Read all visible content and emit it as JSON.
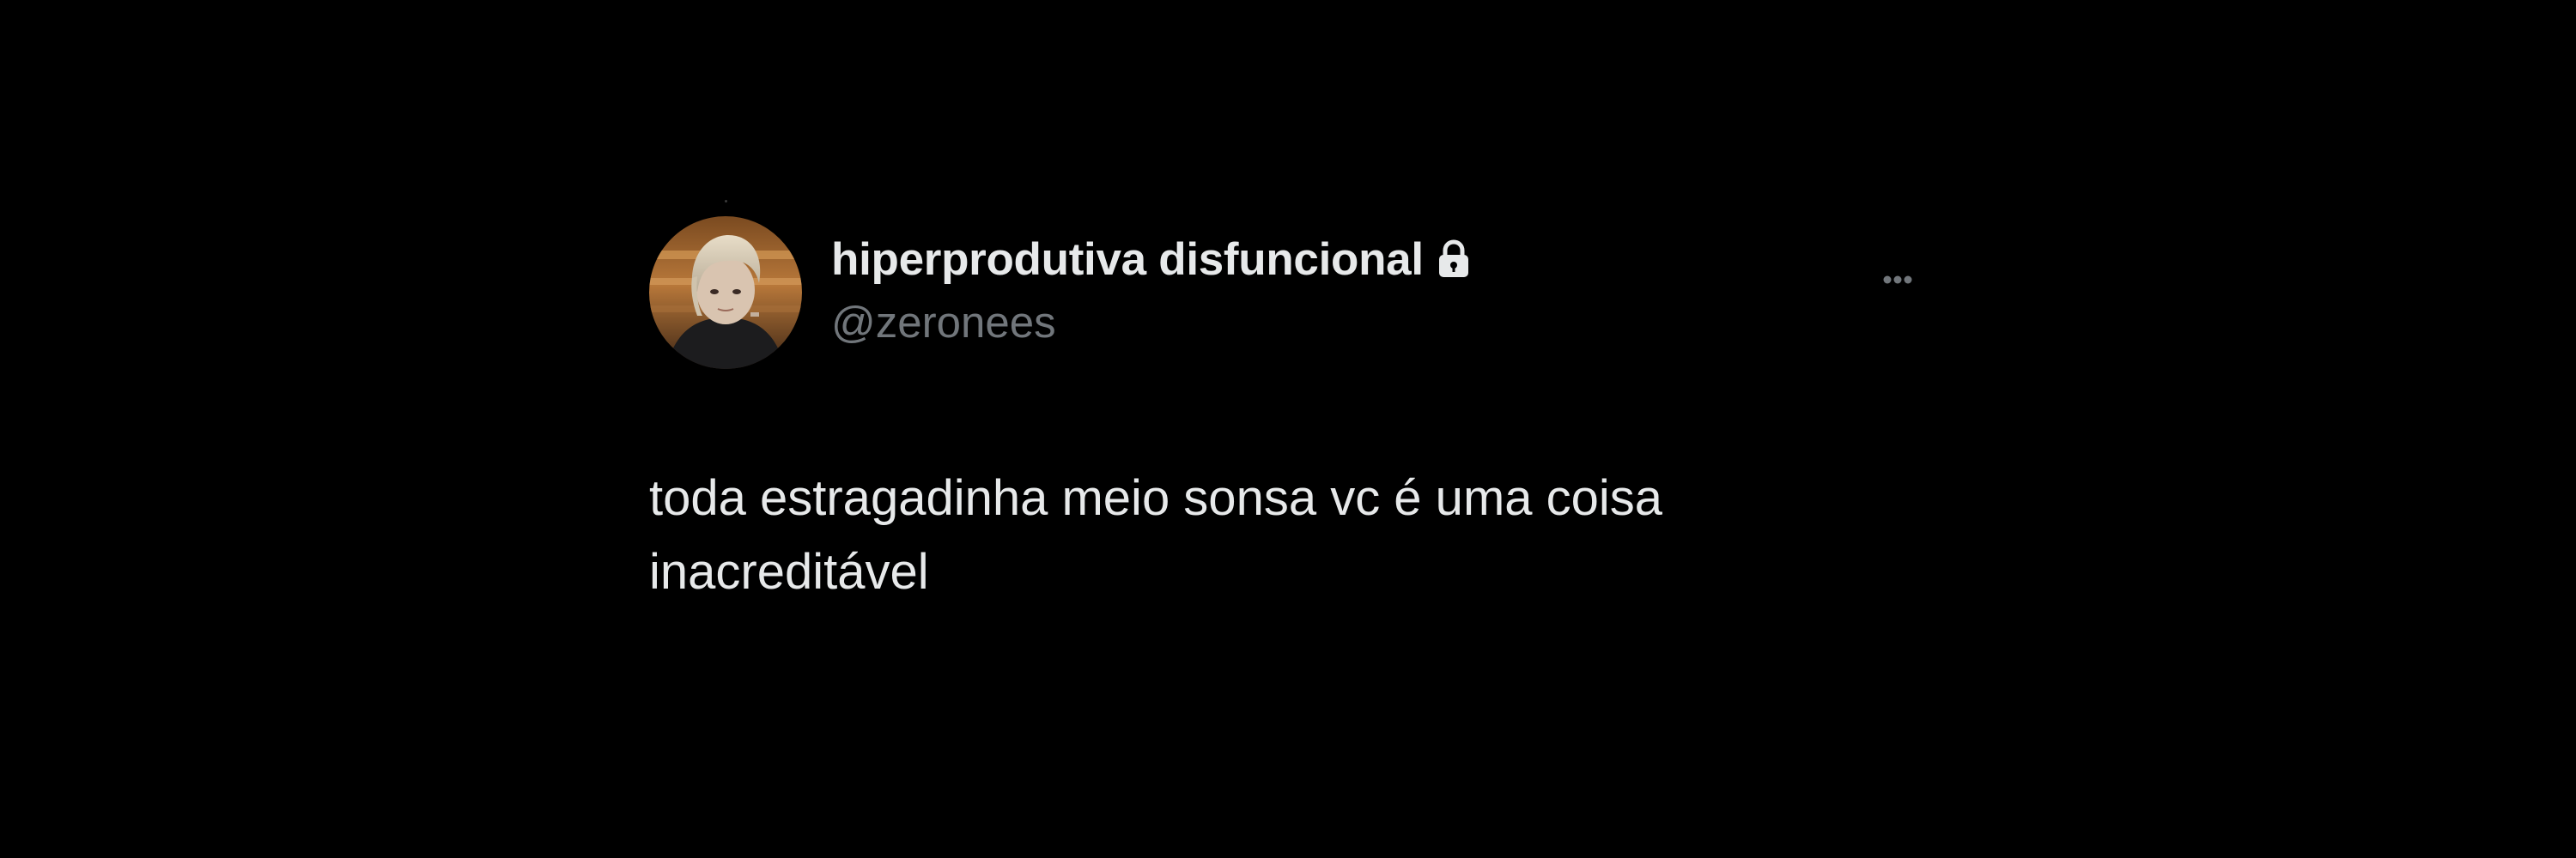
{
  "tweet": {
    "display_name": "hiperprodutiva disfuncional",
    "handle": "@zeronees",
    "text_lines": [
      "toda estragadinha meio sonsa vc é uma coisa",
      "inacreditável"
    ],
    "icons": {
      "lock": "lock-icon",
      "more": "more-options-icon"
    },
    "colors": {
      "background": "#000000",
      "primary_text": "#e7e9ea",
      "secondary_text": "#71767b"
    }
  }
}
